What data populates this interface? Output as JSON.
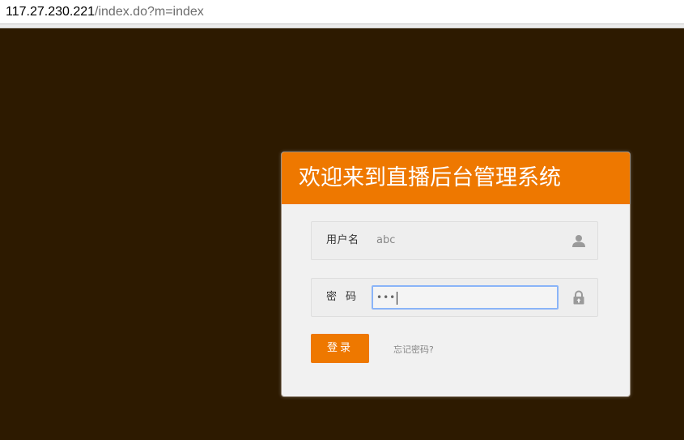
{
  "browser": {
    "url_host": "117.27.230.221",
    "url_path": "/index.do?m=index"
  },
  "login": {
    "title": "欢迎来到直播后台管理系统",
    "username_label": "用户名",
    "username_value": "abc",
    "password_label": "密码",
    "password_value": "•••",
    "submit_label": "登录",
    "forgot_link": "忘记密码?",
    "user_icon": "user-icon",
    "lock_icon": "lock-icon"
  },
  "colors": {
    "background": "#2d1a00",
    "accent": "#ee7800",
    "panel": "#f1f1f1"
  }
}
